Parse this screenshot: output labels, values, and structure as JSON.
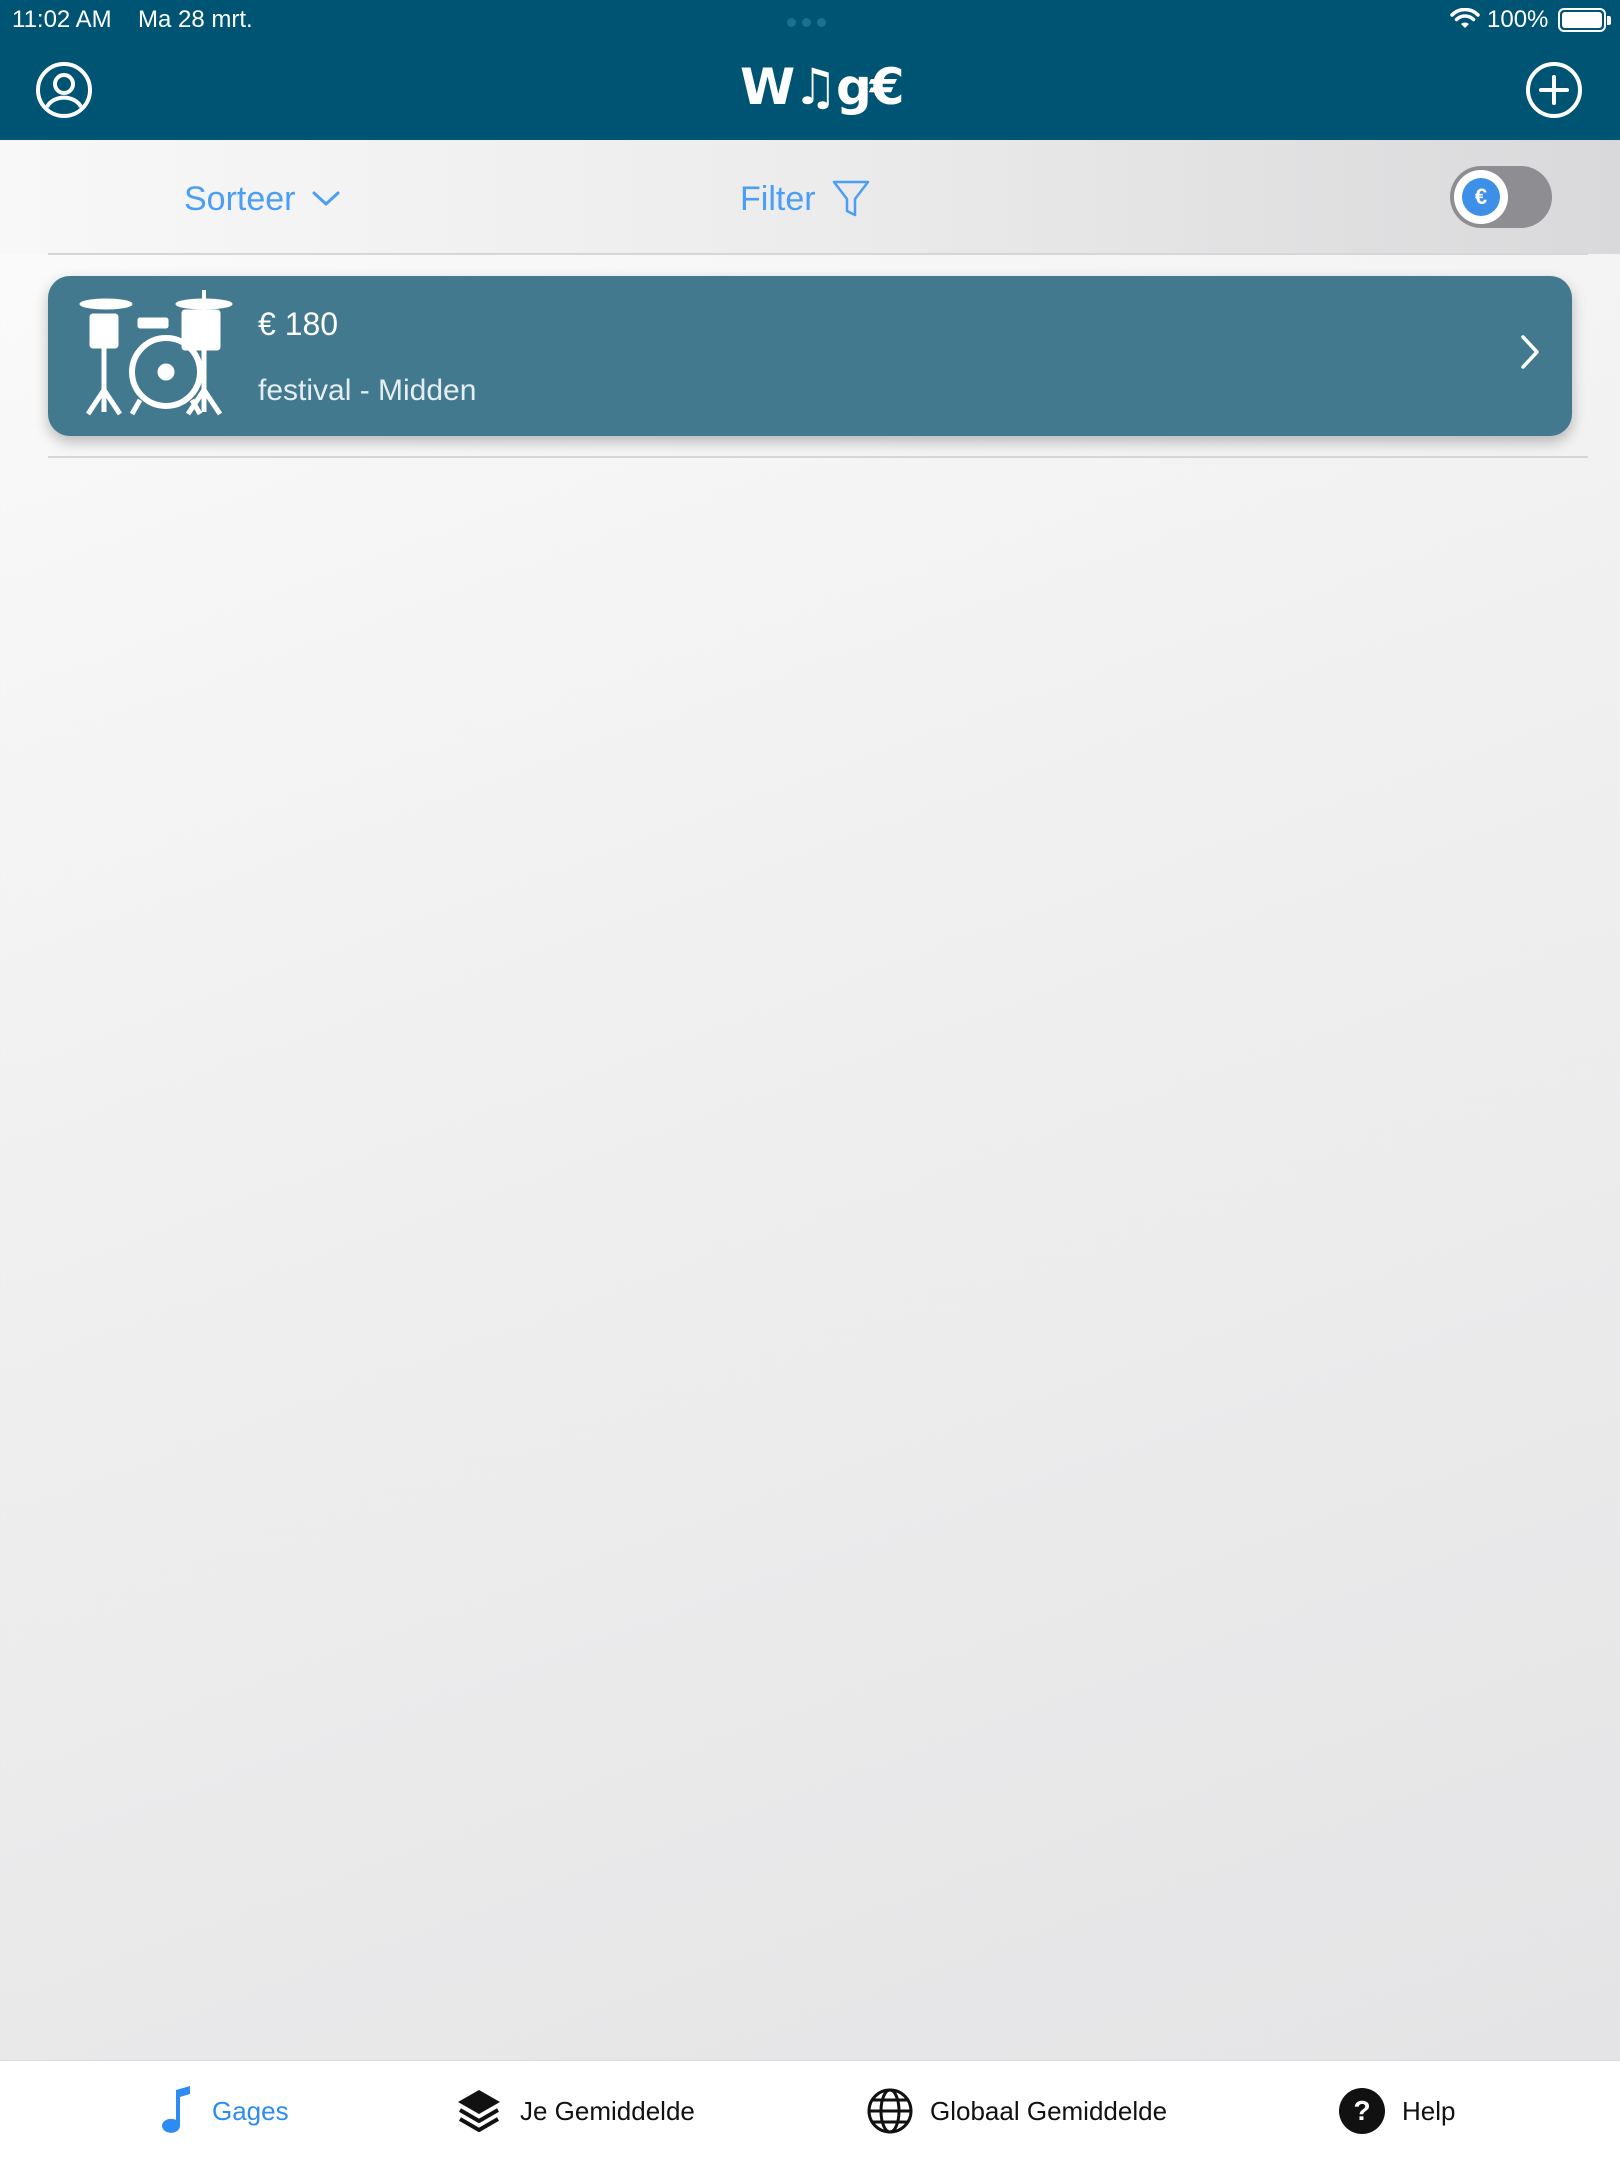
{
  "status_bar": {
    "time": "11:02 AM",
    "date": "Ma 28 mrt.",
    "battery": "100%"
  },
  "header": {
    "logo": "W♫g€",
    "profile_icon": "person-circle-icon",
    "add_icon": "plus-circle-icon"
  },
  "toolbar": {
    "sort_label": "Sorteer",
    "filter_label": "Filter",
    "currency_toggle_symbol": "€"
  },
  "gigs": [
    {
      "icon": "drum-kit-icon",
      "amount": "€ 180",
      "subtitle": "festival - Midden"
    }
  ],
  "tabbar": {
    "items": [
      {
        "label": "Gages",
        "icon": "music-note-icon",
        "active": true
      },
      {
        "label": "Je Gemiddelde",
        "icon": "layers-icon",
        "active": false
      },
      {
        "label": "Globaal Gemiddelde",
        "icon": "globe-icon",
        "active": false
      },
      {
        "label": "Help",
        "icon": "question-circle-icon",
        "active": false
      }
    ]
  },
  "colors": {
    "header": "#005473",
    "card": "#43798f",
    "accent": "#2c8cf2"
  }
}
